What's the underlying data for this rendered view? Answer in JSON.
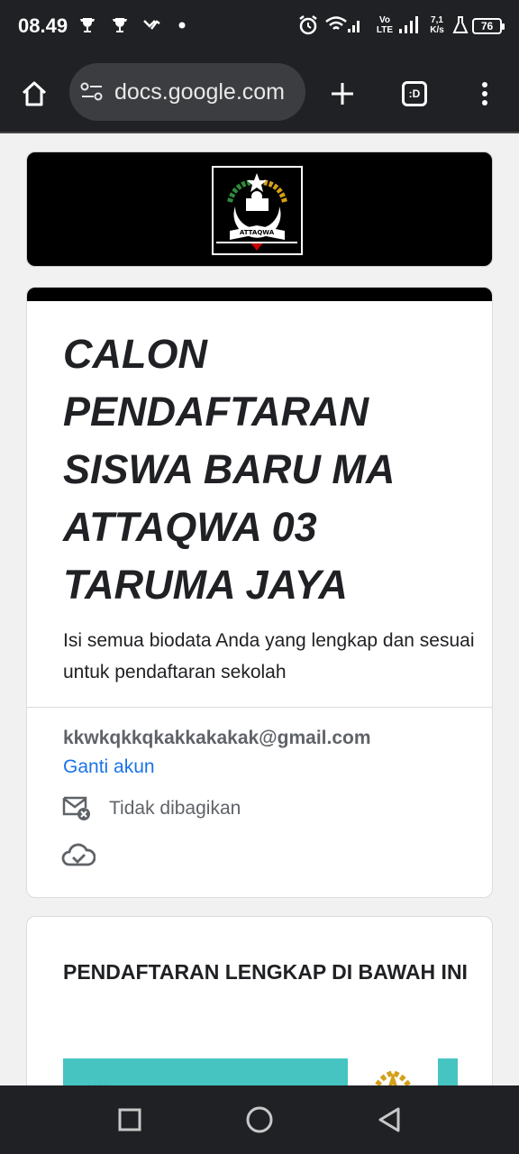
{
  "status_bar": {
    "time": "08.49",
    "network": "Vo LTE",
    "speed": "7,1 K/s",
    "battery": "76"
  },
  "browser": {
    "url": "docs.google.com",
    "tabs_label": ":D"
  },
  "form": {
    "title": "CALON PENDAFTARAN SISWA BARU MA ATTAQWA 03 TARUMA JAYA",
    "description": "Isi semua biodata Anda yang lengkap dan sesuai untuk pendaftaran sekolah",
    "email": "kkwkqkkqkakkakakak@gmail.com",
    "switch_account": "Ganti akun",
    "not_shared": "Tidak dibagikan"
  },
  "section": {
    "title": "PENDAFTARAN LENGKAP DI BAWAH INI"
  },
  "logo": {
    "text": "ATTAQWA"
  },
  "colors": {
    "accent_link": "#1a73e8",
    "header_bar": "#000000",
    "image_teal": "#45c4c2"
  }
}
